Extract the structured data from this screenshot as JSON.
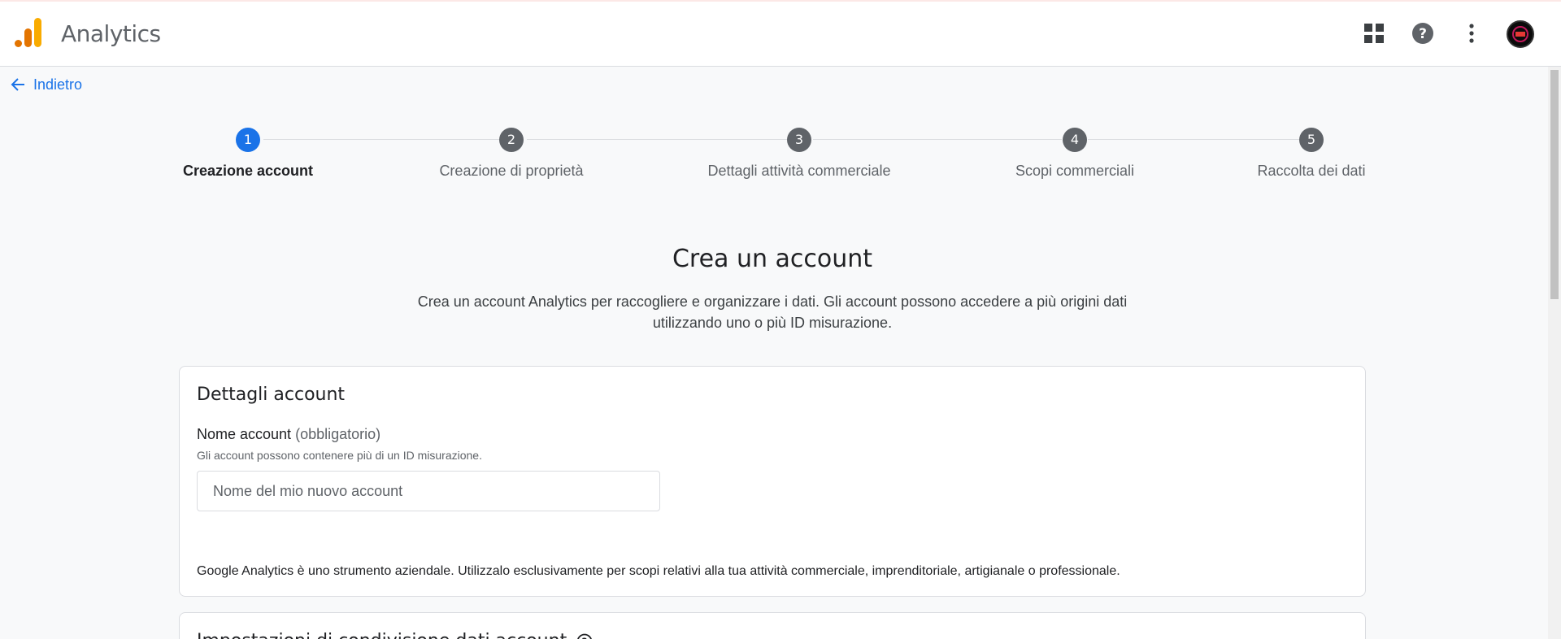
{
  "header": {
    "app_title": "Analytics",
    "logo_colors": [
      "#E37400",
      "#F9AB00"
    ],
    "icons": [
      "apps-icon",
      "help-icon",
      "more-vert-icon",
      "avatar"
    ]
  },
  "nav": {
    "back_label": "Indietro"
  },
  "stepper": {
    "steps": [
      {
        "number": "1",
        "label": "Creazione account",
        "active": true
      },
      {
        "number": "2",
        "label": "Creazione di proprietà",
        "active": false
      },
      {
        "number": "3",
        "label": "Dettagli attività commerciale",
        "active": false
      },
      {
        "number": "4",
        "label": "Scopi commerciali",
        "active": false
      },
      {
        "number": "5",
        "label": "Raccolta dei dati",
        "active": false
      }
    ],
    "active_color": "#1a73e8",
    "inactive_color": "#5f6368"
  },
  "main": {
    "title": "Crea un account",
    "description": "Crea un account Analytics per raccogliere e organizzare i dati. Gli account possono accedere a più origini dati utilizzando uno o più ID misurazione."
  },
  "account_details": {
    "title": "Dettagli account",
    "field_label": "Nome account",
    "field_optional": "(obbligatorio)",
    "field_hint": "Gli account possono contenere più di un ID misurazione.",
    "placeholder": "Nome del mio nuovo account",
    "value": "",
    "disclaimer": "Google Analytics è uno strumento aziendale. Utilizzalo esclusivamente per scopi relativi alla tua attività commerciale, imprenditoriale, artigianale o professionale."
  },
  "data_sharing": {
    "title": "Impostazioni di condivisione dati account"
  }
}
